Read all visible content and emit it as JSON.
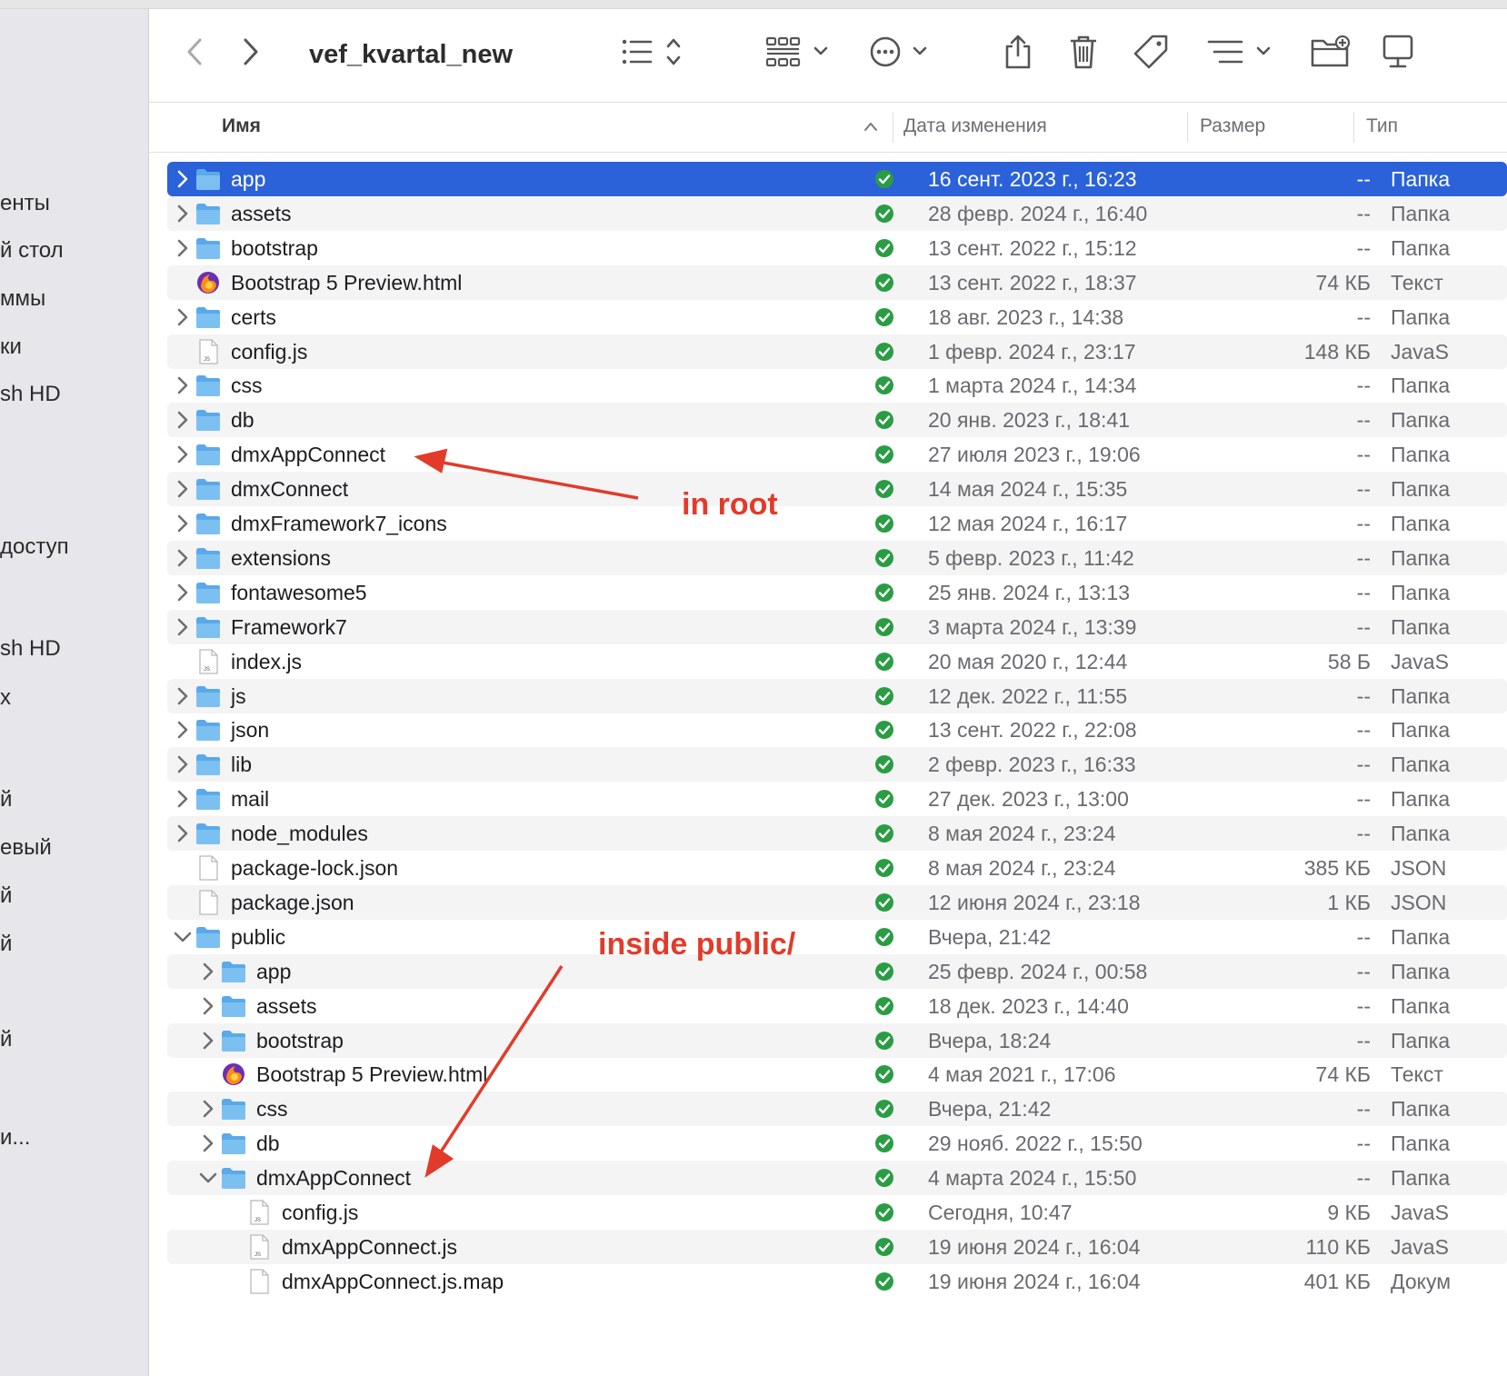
{
  "window": {
    "title": "vef_kvartal_new"
  },
  "toolbar": {
    "back_icon": "chevron-left-icon",
    "forward_icon": "chevron-right-icon",
    "view_icon": "list-view-icon",
    "group_icon": "grid-icon",
    "action_icon": "more-icon",
    "share_icon": "share-icon",
    "delete_icon": "trash-icon",
    "tag_icon": "tag-icon",
    "sort_icon": "sort-icon",
    "new_folder_icon": "new-folder-icon",
    "desktop_icon": "desktop-icon"
  },
  "sidebar": {
    "items": [
      "енты",
      "й стол",
      "ммы",
      "ки",
      "sh HD",
      "доступ",
      "sh HD",
      "х",
      "й",
      "евый",
      "й",
      "й",
      "й",
      "и..."
    ]
  },
  "columns": {
    "name": "Имя",
    "date": "Дата изменения",
    "size": "Размер",
    "type": "Тип"
  },
  "rows": [
    {
      "name": "app",
      "date": "16 сент. 2023 г., 16:23",
      "size": "--",
      "type": "Папка",
      "kind": "folder",
      "indent": 0,
      "expander": "closed",
      "selected": true
    },
    {
      "name": "assets",
      "date": "28 февр. 2024 г., 16:40",
      "size": "--",
      "type": "Папка",
      "kind": "folder",
      "indent": 0,
      "expander": "closed"
    },
    {
      "name": "bootstrap",
      "date": "13 сент. 2022 г., 15:12",
      "size": "--",
      "type": "Папка",
      "kind": "folder",
      "indent": 0,
      "expander": "closed"
    },
    {
      "name": "Bootstrap 5 Preview.html",
      "date": "13 сент. 2022 г., 18:37",
      "size": "74 КБ",
      "type": "Текст",
      "kind": "firefox",
      "indent": 0,
      "expander": "none"
    },
    {
      "name": "certs",
      "date": "18 авг. 2023 г., 14:38",
      "size": "--",
      "type": "Папка",
      "kind": "folder",
      "indent": 0,
      "expander": "closed"
    },
    {
      "name": "config.js",
      "date": "1 февр. 2024 г., 23:17",
      "size": "148 КБ",
      "type": "JavaS",
      "kind": "js",
      "indent": 0,
      "expander": "none"
    },
    {
      "name": "css",
      "date": "1 марта 2024 г., 14:34",
      "size": "--",
      "type": "Папка",
      "kind": "folder",
      "indent": 0,
      "expander": "closed"
    },
    {
      "name": "db",
      "date": "20 янв. 2023 г., 18:41",
      "size": "--",
      "type": "Папка",
      "kind": "folder",
      "indent": 0,
      "expander": "closed"
    },
    {
      "name": "dmxAppConnect",
      "date": "27 июля 2023 г., 19:06",
      "size": "--",
      "type": "Папка",
      "kind": "folder",
      "indent": 0,
      "expander": "closed"
    },
    {
      "name": "dmxConnect",
      "date": "14 мая 2024 г., 15:35",
      "size": "--",
      "type": "Папка",
      "kind": "folder",
      "indent": 0,
      "expander": "closed"
    },
    {
      "name": "dmxFramework7_icons",
      "date": "12 мая 2024 г., 16:17",
      "size": "--",
      "type": "Папка",
      "kind": "folder",
      "indent": 0,
      "expander": "closed"
    },
    {
      "name": "extensions",
      "date": "5 февр. 2023 г., 11:42",
      "size": "--",
      "type": "Папка",
      "kind": "folder",
      "indent": 0,
      "expander": "closed"
    },
    {
      "name": "fontawesome5",
      "date": "25 янв. 2024 г., 13:13",
      "size": "--",
      "type": "Папка",
      "kind": "folder",
      "indent": 0,
      "expander": "closed"
    },
    {
      "name": "Framework7",
      "date": "3 марта 2024 г., 13:39",
      "size": "--",
      "type": "Папка",
      "kind": "folder",
      "indent": 0,
      "expander": "closed"
    },
    {
      "name": "index.js",
      "date": "20 мая 2020 г., 12:44",
      "size": "58 Б",
      "type": "JavaS",
      "kind": "js",
      "indent": 0,
      "expander": "none"
    },
    {
      "name": "js",
      "date": "12 дек. 2022 г., 11:55",
      "size": "--",
      "type": "Папка",
      "kind": "folder",
      "indent": 0,
      "expander": "closed"
    },
    {
      "name": "json",
      "date": "13 сент. 2022 г., 22:08",
      "size": "--",
      "type": "Папка",
      "kind": "folder",
      "indent": 0,
      "expander": "closed"
    },
    {
      "name": "lib",
      "date": "2 февр. 2023 г., 16:33",
      "size": "--",
      "type": "Папка",
      "kind": "folder",
      "indent": 0,
      "expander": "closed"
    },
    {
      "name": "mail",
      "date": "27 дек. 2023 г., 13:00",
      "size": "--",
      "type": "Папка",
      "kind": "folder",
      "indent": 0,
      "expander": "closed"
    },
    {
      "name": "node_modules",
      "date": "8 мая 2024 г., 23:24",
      "size": "--",
      "type": "Папка",
      "kind": "folder",
      "indent": 0,
      "expander": "closed"
    },
    {
      "name": "package-lock.json",
      "date": "8 мая 2024 г., 23:24",
      "size": "385 КБ",
      "type": "JSON",
      "kind": "doc",
      "indent": 0,
      "expander": "none"
    },
    {
      "name": "package.json",
      "date": "12 июня 2024 г., 23:18",
      "size": "1 КБ",
      "type": "JSON",
      "kind": "doc",
      "indent": 0,
      "expander": "none"
    },
    {
      "name": "public",
      "date": "Вчера, 21:42",
      "size": "--",
      "type": "Папка",
      "kind": "folder",
      "indent": 0,
      "expander": "open"
    },
    {
      "name": "app",
      "date": "25 февр. 2024 г., 00:58",
      "size": "--",
      "type": "Папка",
      "kind": "folder",
      "indent": 1,
      "expander": "closed"
    },
    {
      "name": "assets",
      "date": "18 дек. 2023 г., 14:40",
      "size": "--",
      "type": "Папка",
      "kind": "folder",
      "indent": 1,
      "expander": "closed"
    },
    {
      "name": "bootstrap",
      "date": "Вчера, 18:24",
      "size": "--",
      "type": "Папка",
      "kind": "folder",
      "indent": 1,
      "expander": "closed"
    },
    {
      "name": "Bootstrap 5 Preview.html",
      "date": "4 мая 2021 г., 17:06",
      "size": "74 КБ",
      "type": "Текст",
      "kind": "firefox",
      "indent": 1,
      "expander": "none"
    },
    {
      "name": "css",
      "date": "Вчера, 21:42",
      "size": "--",
      "type": "Папка",
      "kind": "folder",
      "indent": 1,
      "expander": "closed"
    },
    {
      "name": "db",
      "date": "29 нояб. 2022 г., 15:50",
      "size": "--",
      "type": "Папка",
      "kind": "folder",
      "indent": 1,
      "expander": "closed"
    },
    {
      "name": "dmxAppConnect",
      "date": "4 марта 2024 г., 15:50",
      "size": "--",
      "type": "Папка",
      "kind": "folder",
      "indent": 1,
      "expander": "open"
    },
    {
      "name": "config.js",
      "date": "Сегодня, 10:47",
      "size": "9 КБ",
      "type": "JavaS",
      "kind": "js",
      "indent": 2,
      "expander": "none"
    },
    {
      "name": "dmxAppConnect.js",
      "date": "19 июня 2024 г., 16:04",
      "size": "110 КБ",
      "type": "JavaS",
      "kind": "js",
      "indent": 2,
      "expander": "none"
    },
    {
      "name": "dmxAppConnect.js.map",
      "date": "19 июня 2024 г., 16:04",
      "size": "401 КБ",
      "type": "Докум",
      "kind": "doc",
      "indent": 2,
      "expander": "none"
    }
  ],
  "annotations": {
    "root_label": "in root",
    "public_label": "inside public/"
  },
  "colors": {
    "selection": "#2b62d9",
    "folder": "#5aa9ea",
    "status": "#2a9d44",
    "annotation": "#e23b2a"
  }
}
